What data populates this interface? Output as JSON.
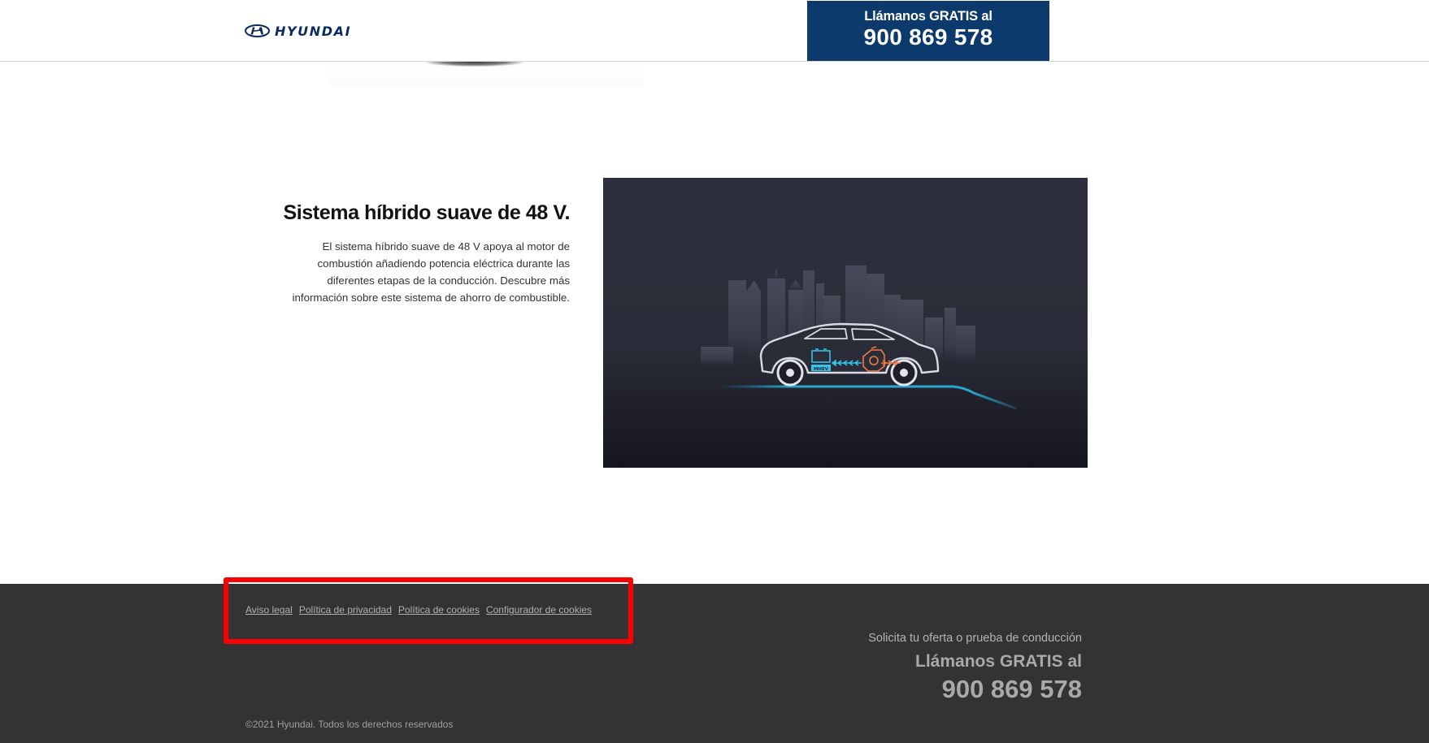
{
  "header": {
    "brand": "HYUNDAI",
    "call_label": "Llámanos GRATIS al",
    "call_number": "900 869 578",
    "brand_color": "#0a2b5f",
    "call_box_color": "#0c3a6c"
  },
  "feature": {
    "title": "Sistema híbrido suave de 48 V.",
    "description": "El sistema híbrido suave de 48 V apoya al motor de combustión añadiendo potencia eléctrica durante las diferentes etapas de la conducción. Descubre más información sobre este sistema de ahorro de combustible.",
    "media_badge": "MHEV",
    "media_icons": [
      "battery-icon",
      "engine-icon",
      "car-icon",
      "city-skyline"
    ]
  },
  "footer": {
    "links": [
      {
        "label": "Aviso legal"
      },
      {
        "label": "Política de privacidad"
      },
      {
        "label": "Política de cookies"
      },
      {
        "label": "Configurador de cookies"
      }
    ],
    "cta_text": "Solicita tu oferta o prueba de conducción",
    "call_label": "Llámanos GRATIS al",
    "call_number": "900 869 578",
    "copyright": "©2021 Hyundai. Todos los derechos reservados",
    "background_color": "#333333",
    "highlight_color": "#ff0000"
  }
}
